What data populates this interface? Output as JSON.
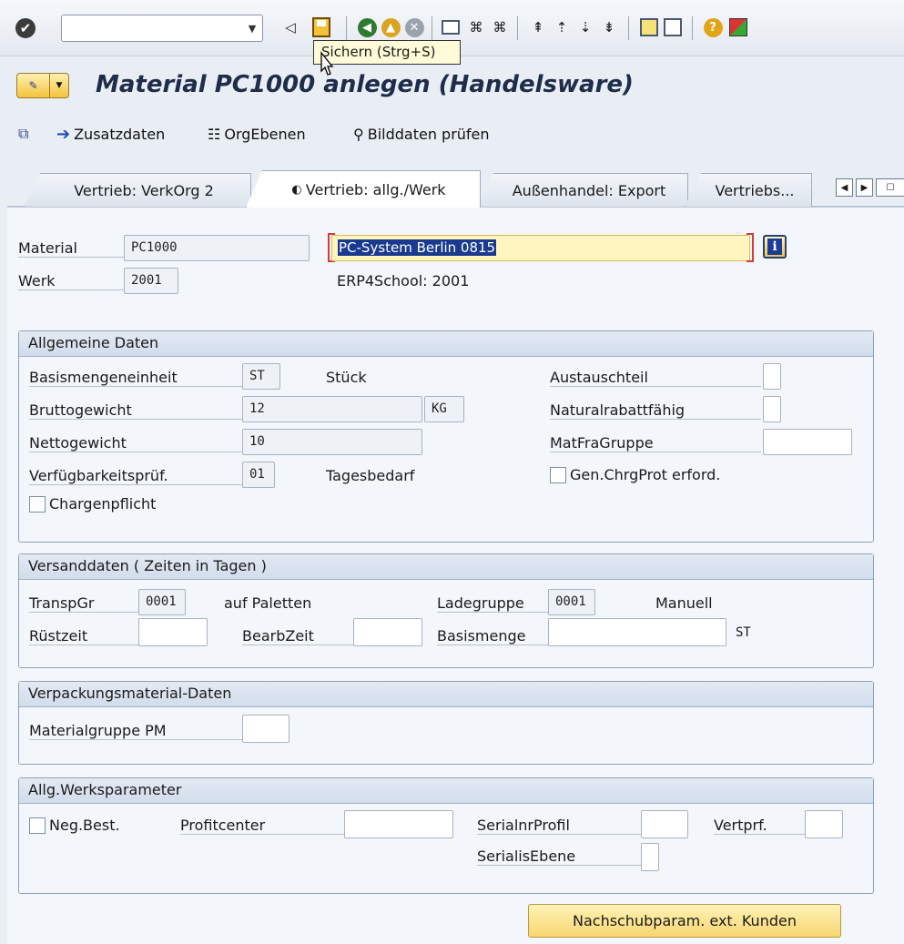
{
  "toolbar": {
    "tooltip": "Sichern  (Strg+S)",
    "command_field_value": ""
  },
  "title": {
    "text": "Material PC1000 anlegen (Handelsware)"
  },
  "app_toolbar": {
    "zusatzdaten": "Zusatzdaten",
    "org_ebenen": "OrgEbenen",
    "bilddaten": "Bilddaten prüfen"
  },
  "tabs": [
    {
      "label": "Vertrieb: VerkOrg 2"
    },
    {
      "label": "Vertrieb: allg./Werk"
    },
    {
      "label": "Außenhandel: Export"
    },
    {
      "label": "Vertriebs..."
    }
  ],
  "header_fields": {
    "material_label": "Material",
    "material_value": "PC1000",
    "material_desc": "PC-System Berlin 0815",
    "werk_label": "Werk",
    "werk_value": "2001",
    "werk_desc": "ERP4School: 2001"
  },
  "allgemeine_daten": {
    "title": "Allgemeine Daten",
    "basismengeneinheit_label": "Basismengeneinheit",
    "basismengeneinheit_value": "ST",
    "basismengeneinheit_text": "Stück",
    "bruttogewicht_label": "Bruttogewicht",
    "bruttogewicht_value": "12",
    "gewicht_einheit": "KG",
    "nettogewicht_label": "Nettogewicht",
    "nettogewicht_value": "10",
    "verfuegbarkeit_label": "Verfügbarkeitsprüf.",
    "verfuegbarkeit_value": "01",
    "verfuegbarkeit_text": "Tagesbedarf",
    "chargenpflicht_label": "Chargenpflicht",
    "austauschteil_label": "Austauschteil",
    "naturalrabatt_label": "Naturalrabattfähig",
    "matfragruppe_label": "MatFraGruppe",
    "chrgprot_label": "Gen.ChrgProt erford."
  },
  "versanddaten": {
    "title": "Versanddaten ( Zeiten in Tagen )",
    "transpgr_label": "TranspGr",
    "transpgr_value": "0001",
    "transpgr_text": "auf Paletten",
    "ladegruppe_label": "Ladegruppe",
    "ladegruppe_value": "0001",
    "ladegruppe_text": "Manuell",
    "ruestzeit_label": "Rüstzeit",
    "bearbzeit_label": "BearbZeit",
    "basismenge_label": "Basismenge",
    "basismenge_unit": "ST"
  },
  "verpackung": {
    "title": "Verpackungsmaterial-Daten",
    "materialgruppe_label": "Materialgruppe PM"
  },
  "werksparameter": {
    "title": "Allg.Werksparameter",
    "negbest_label": "Neg.Best.",
    "profitcenter_label": "Profitcenter",
    "serialnrprofil_label": "SerialnrProfil",
    "vertprf_label": "Vertprf.",
    "serialisebene_label": "SerialisEbene"
  },
  "bottom_button": "Nachschubparam. ext. Kunden",
  "colors": {
    "highlight_field": "#fff6bf",
    "selection": "#1a3a8f",
    "title_text": "#1f2d4a"
  }
}
